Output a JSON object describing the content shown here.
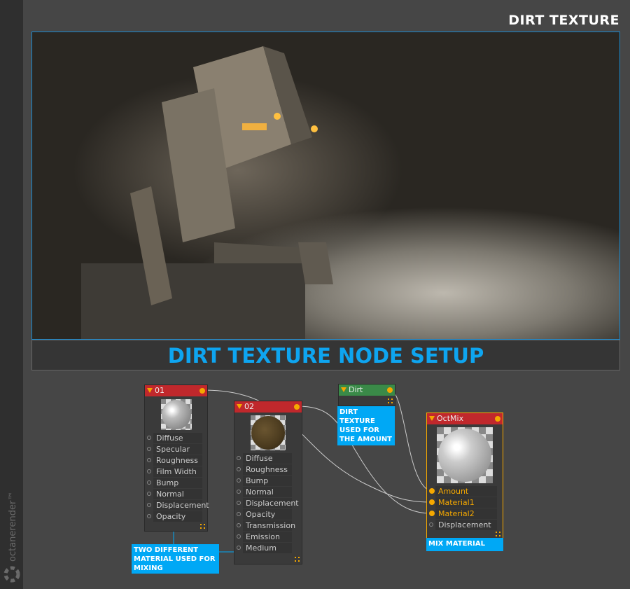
{
  "title": "DIRT TEXTURE",
  "caption": "DIRT TEXTURE NODE SETUP",
  "brand": "octanerender™",
  "nodes": {
    "n01": {
      "name": "01",
      "pins": [
        "Diffuse",
        "Specular",
        "Roughness",
        "Film Width",
        "Bump",
        "Normal",
        "Displacement",
        "Opacity"
      ]
    },
    "n02": {
      "name": "02",
      "pins": [
        "Diffuse",
        "Roughness",
        "Bump",
        "Normal",
        "Displacement",
        "Opacity",
        "Transmission",
        "Emission",
        "Medium"
      ]
    },
    "dirt": {
      "name": "Dirt"
    },
    "mix": {
      "name": "OctMix",
      "pins": [
        "Amount",
        "Material1",
        "Material2",
        "Displacement"
      ]
    }
  },
  "notes": {
    "materials": "TWO DIFFERENT MATERIAL USED FOR MIXING",
    "dirt": "DIRT TEXTURE USED FOR THE AMOUNT",
    "mix": "MIX MATERIAL"
  },
  "colors": {
    "accent": "#00a8f5",
    "material_header": "#c0282c",
    "texture_header": "#3a8a48",
    "pin_active": "#f5a800"
  }
}
